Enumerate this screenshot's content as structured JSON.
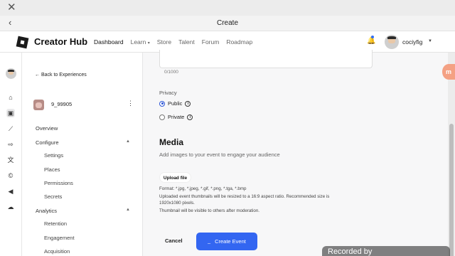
{
  "window": {
    "title": "Create"
  },
  "topnav": {
    "brand": "Creator Hub",
    "links": [
      "Dashboard",
      "Learn",
      "Store",
      "Talent",
      "Forum",
      "Roadmap"
    ],
    "learn_caret": "▾",
    "username": "cociyfig"
  },
  "sidebar": {
    "back_label": "Back to Experiences",
    "experience_name": "9_99905",
    "items": [
      {
        "label": "Overview"
      },
      {
        "label": "Configure"
      },
      {
        "label": "Settings"
      },
      {
        "label": "Places"
      },
      {
        "label": "Permissions"
      },
      {
        "label": "Secrets"
      },
      {
        "label": "Analytics"
      },
      {
        "label": "Retention"
      },
      {
        "label": "Engagement"
      },
      {
        "label": "Acquisition"
      }
    ]
  },
  "form": {
    "char_counter": "0/1000",
    "privacy_label": "Privacy",
    "privacy_options": [
      {
        "label": "Public",
        "selected": true
      },
      {
        "label": "Private",
        "selected": false
      }
    ],
    "media_title": "Media",
    "media_subtitle": "Add images to your event to engage your audience",
    "upload_label": "Upload file",
    "format_line": "Format: *.jpg, *.jpeg, *.gif, *.png, *.tga, *.bmp",
    "resize_line_1": "Uploaded event thumbnails will be resized to a 16:9 aspect ratio. Recommended size is",
    "resize_line_2": "1920x1080 pixels.",
    "moderation_line": "Thumbnail will be visible to others after moderation.",
    "cancel_label": "Cancel",
    "create_label": "Create Event"
  },
  "overlay": {
    "bubble": "m",
    "recorder": "Recorded by"
  },
  "colors": {
    "accent": "#3366f1",
    "radio_selected": "#2c55d6",
    "notification_dot": "#2f6df6"
  },
  "icons": [
    "close-icon",
    "back-arrow-icon",
    "bell-icon",
    "home-icon",
    "experiences-icon",
    "analytics-icon",
    "monetization-icon",
    "translate-icon",
    "currency-icon",
    "megaphone-icon",
    "cloud-icon",
    "info-icon",
    "kebab-icon",
    "chevron-up-icon",
    "chevron-down-icon"
  ]
}
